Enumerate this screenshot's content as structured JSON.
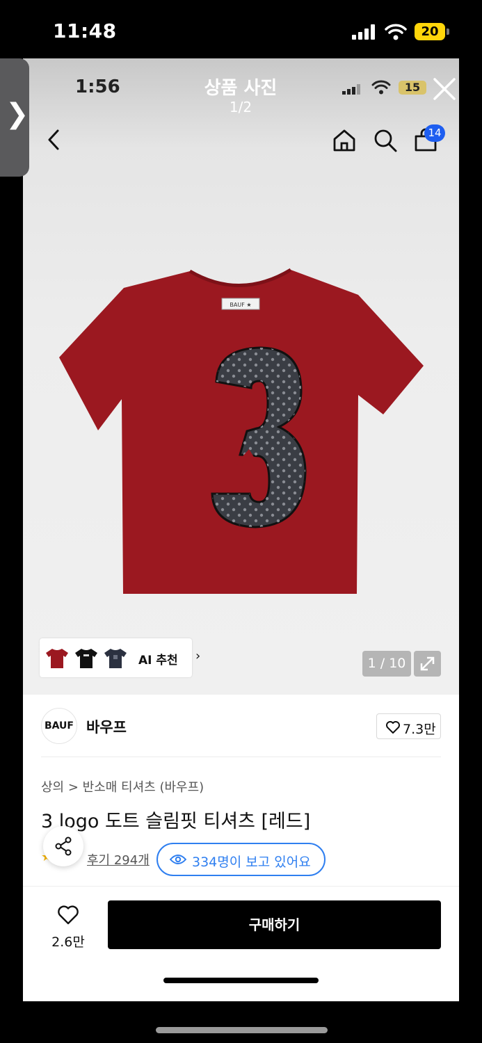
{
  "outer_status": {
    "time": "11:48",
    "battery": "20"
  },
  "side_handle": {
    "glyph": "❯"
  },
  "viewer": {
    "time": "1:56",
    "title": "상품 사진",
    "counter": "1/2",
    "battery": "15",
    "close_icon": "close-icon"
  },
  "nav": {
    "back_icon": "chevron-left-icon",
    "home_icon": "home-icon",
    "search_icon": "search-icon",
    "cart_icon": "bag-icon",
    "cart_count": "14"
  },
  "gallery": {
    "ai_label": "AI 추천",
    "ai_chevron": "›",
    "page_indicator": "1 / 10",
    "colors": {
      "shirt": "#9b1820",
      "patch": "#3a3d44"
    }
  },
  "brand": {
    "logo_text": "BAUF",
    "name": "바우프",
    "likes": "7.3만"
  },
  "product": {
    "breadcrumb": "상의 > 반소매 티셔츠 (바우프)",
    "title": "3 logo 도트 슬림핏 티셔츠 [레드]",
    "rating_star": "★",
    "reviews": "후기 294개",
    "viewers": "334명이 보고 있어요"
  },
  "bottom_bar": {
    "wish_count": "2.6만",
    "buy_label": "구매하기"
  }
}
